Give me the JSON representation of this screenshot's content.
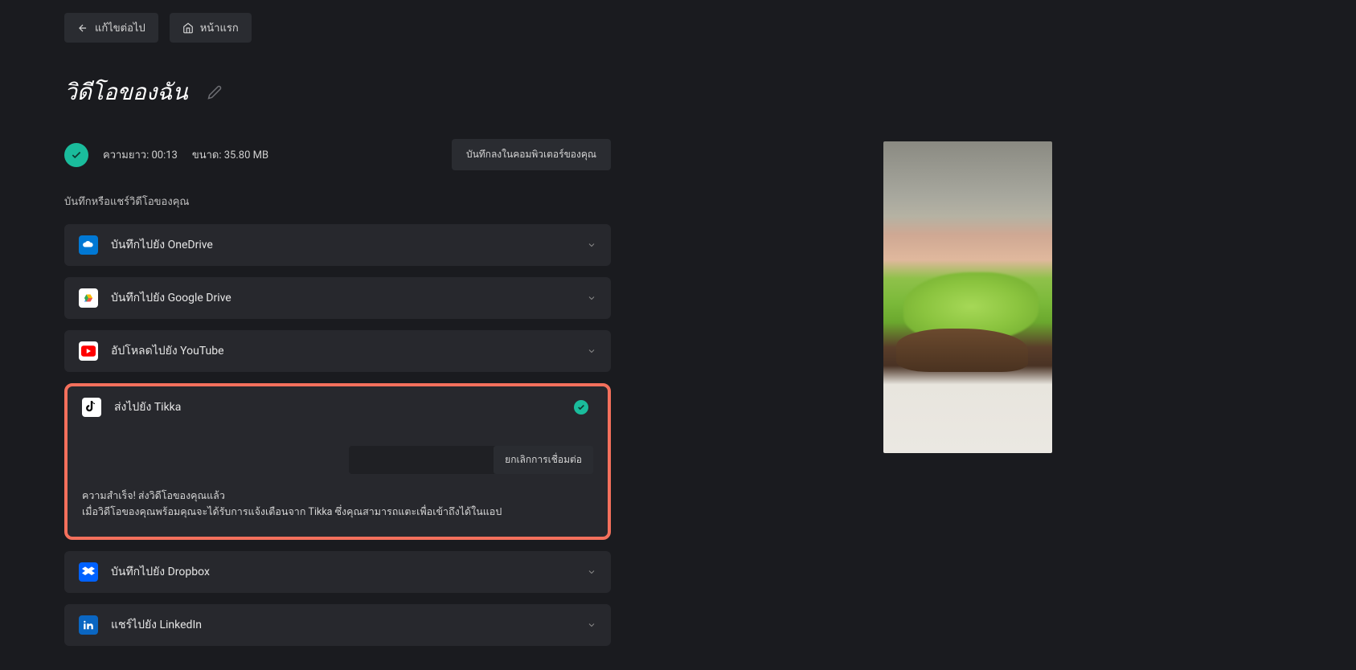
{
  "topButtons": {
    "editNext": "แก้ไขต่อไป",
    "home": "หน้าแรก"
  },
  "pageTitle": "วิดีโอของฉัน",
  "meta": {
    "lengthLabel": "ความยาว:",
    "lengthValue": "00:13",
    "sizeLabel": "ขนาด:",
    "sizeValue": "35.80 MB",
    "saveToComputer": "บันทึกลงในคอมพิวเตอร์ของคุณ"
  },
  "sectionLabel": "บันทึกหรือแชร์วิดีโอของคุณ",
  "shareItems": {
    "onedrive": "บันทึกไปยัง OneDrive",
    "gdrive": "บันทึกไปยัง Google Drive",
    "youtube": "อัปโหลดไปยัง YouTube",
    "tiktok": "ส่งไปยัง Tikka",
    "dropbox": "บันทึกไปยัง Dropbox",
    "linkedin": "แชร์ไปยัง LinkedIn"
  },
  "tiktokExpanded": {
    "disconnect": "ยกเลิกการเชื่อมต่อ",
    "successLine1": "ความสำเร็จ! ส่งวิดีโอของคุณแล้ว",
    "successLine2": "เมื่อวิดีโอของคุณพร้อมคุณจะได้รับการแจ้งเตือนจาก Tikka ซึ่งคุณสามารถแตะเพื่อเข้าถึงได้ในแอป"
  }
}
